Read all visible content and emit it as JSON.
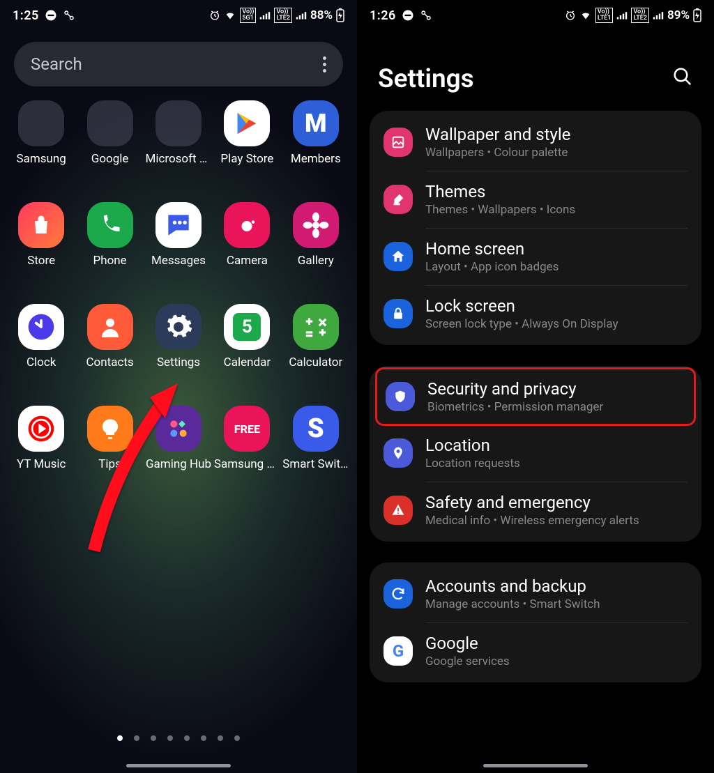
{
  "left": {
    "status": {
      "time": "1:25",
      "battery": "88%"
    },
    "search": {
      "placeholder": "Search"
    },
    "apps": [
      {
        "name": "Samsung",
        "type": "folder"
      },
      {
        "name": "Google",
        "type": "folder"
      },
      {
        "name": "Microsoft A...",
        "type": "folder"
      },
      {
        "name": "Play Store",
        "bg": "#fff",
        "glyph": "play"
      },
      {
        "name": "Members",
        "bg": "#2e5fd9",
        "glyph": "M"
      },
      {
        "name": "Store",
        "bg": "linear-gradient(135deg,#ff3a5f,#ff7a3a)",
        "glyph": "bag"
      },
      {
        "name": "Phone",
        "bg": "#1ba94c",
        "glyph": "phone"
      },
      {
        "name": "Messages",
        "bg": "#fff",
        "glyph": "chat"
      },
      {
        "name": "Camera",
        "bg": "#e9145a",
        "glyph": "camera"
      },
      {
        "name": "Gallery",
        "bg": "#d11a72",
        "glyph": "flower"
      },
      {
        "name": "Clock",
        "bg": "#fff",
        "glyph": "clock"
      },
      {
        "name": "Contacts",
        "bg": "#ff5a3a",
        "glyph": "person"
      },
      {
        "name": "Settings",
        "bg": "#2c3b59",
        "glyph": "gear"
      },
      {
        "name": "Calendar",
        "bg": "#fff",
        "glyph": "5"
      },
      {
        "name": "Calculator",
        "bg": "#3fa93f",
        "glyph": "calc"
      },
      {
        "name": "YT Music",
        "bg": "#fff",
        "glyph": "ytm"
      },
      {
        "name": "Tips",
        "bg": "#ff7a1a",
        "glyph": "bulb"
      },
      {
        "name": "Gaming Hub",
        "bg": "#5a2a9a",
        "glyph": "game"
      },
      {
        "name": "Samsung Free",
        "bg": "#e9145a",
        "glyph": "FREE"
      },
      {
        "name": "Smart Switch",
        "bg": "#3a5ae9",
        "glyph": "S"
      }
    ],
    "page_count": 8,
    "active_page": 0
  },
  "right": {
    "status": {
      "time": "1:26",
      "battery": "89%"
    },
    "title": "Settings",
    "groups": [
      [
        {
          "icon_bg": "#e0356e",
          "icon": "wallpaper",
          "title": "Wallpaper and style",
          "sub": "Wallpapers  •  Colour palette"
        },
        {
          "icon_bg": "#e0356e",
          "icon": "brush",
          "title": "Themes",
          "sub": "Themes  •  Wallpapers  •  Icons"
        },
        {
          "icon_bg": "#1a63dd",
          "icon": "home",
          "title": "Home screen",
          "sub": "Layout  •  App icon badges"
        },
        {
          "icon_bg": "#1a63dd",
          "icon": "lock",
          "title": "Lock screen",
          "sub": "Screen lock type  •  Always On Display"
        }
      ],
      [
        {
          "icon_bg": "#4a5ad9",
          "icon": "shield",
          "title": "Security and privacy",
          "sub": "Biometrics  •  Permission manager",
          "highlight": true
        },
        {
          "icon_bg": "#4a5ad9",
          "icon": "pin",
          "title": "Location",
          "sub": "Location requests"
        },
        {
          "icon_bg": "#d9302a",
          "icon": "alert",
          "title": "Safety and emergency",
          "sub": "Medical info  •  Wireless emergency alerts"
        }
      ],
      [
        {
          "icon_bg": "#1a63dd",
          "icon": "sync",
          "title": "Accounts and backup",
          "sub": "Manage accounts  •  Smart Switch"
        },
        {
          "icon_bg": "#fff",
          "icon": "G",
          "title": "Google",
          "sub": "Google services"
        }
      ]
    ]
  }
}
